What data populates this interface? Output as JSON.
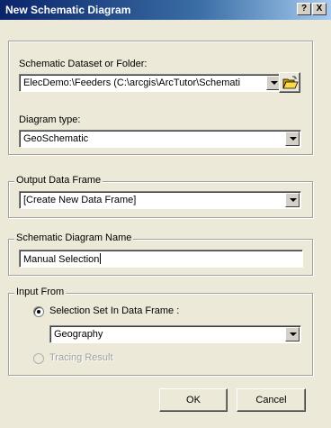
{
  "window": {
    "title": "New Schematic Diagram",
    "help_label": "?",
    "close_label": "X"
  },
  "dataset_group": {
    "dataset_label": "Schematic Dataset or Folder:",
    "dataset_value": "ElecDemo:\\Feeders (C:\\arcgis\\ArcTutor\\Schemati",
    "diagram_type_label": "Diagram type:",
    "diagram_type_value": "GeoSchematic"
  },
  "output_group": {
    "legend": "Output Data Frame",
    "value": "[Create New Data Frame]"
  },
  "name_group": {
    "legend": "Schematic Diagram Name",
    "value": "Manual Selection"
  },
  "input_group": {
    "legend": "Input From",
    "selection_option": "Selection Set In Data Frame :",
    "selection_checked": true,
    "frame_value": "Geography",
    "tracing_option": "Tracing Result",
    "tracing_enabled": false
  },
  "buttons": {
    "ok": "OK",
    "cancel": "Cancel"
  },
  "icons": {
    "browse": "open-folder-icon"
  }
}
